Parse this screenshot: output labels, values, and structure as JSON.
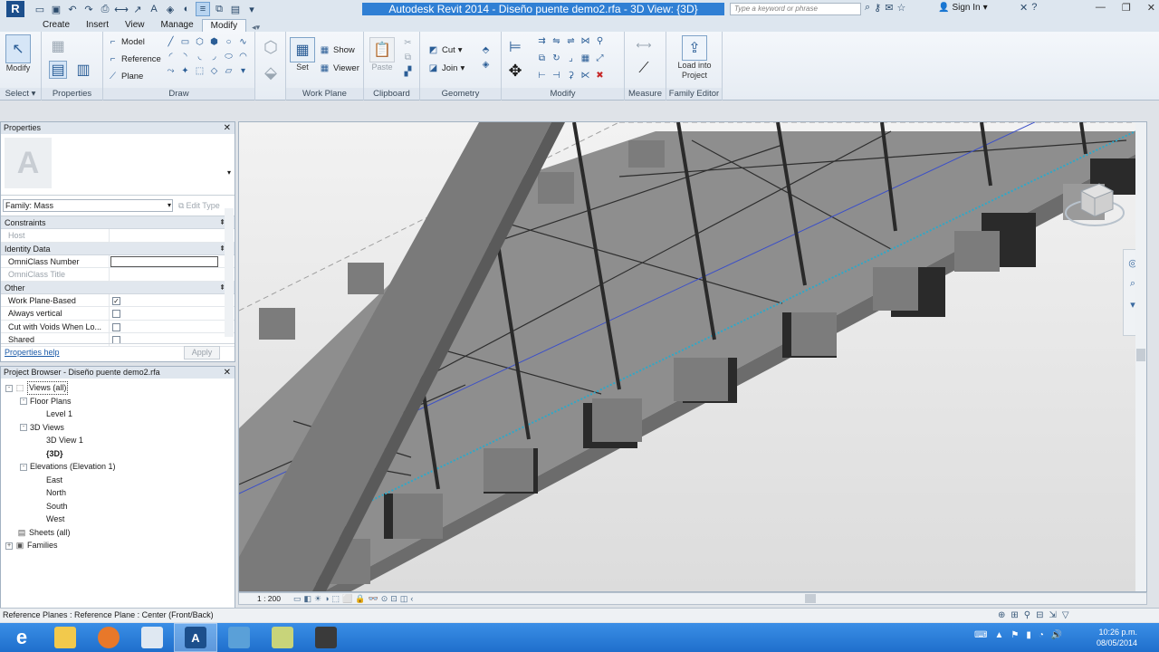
{
  "window": {
    "title": "Autodesk Revit 2014  -  Diseño puente demo2.rfa - 3D View: {3D}",
    "search_placeholder": "Type a keyword or phrase",
    "sign_in": "Sign In"
  },
  "ribbon": {
    "tabs": [
      "Create",
      "Insert",
      "View",
      "Manage",
      "Modify"
    ],
    "active_tab": "Modify",
    "panels": {
      "select": {
        "label": "Select",
        "modify_label": "Modify"
      },
      "properties": {
        "label": "Properties"
      },
      "draw": {
        "label": "Draw",
        "model": "Model",
        "reference": "Reference",
        "plane": "Plane"
      },
      "work_plane": {
        "label": "Work Plane",
        "set": "Set",
        "show": "Show",
        "viewer": "Viewer"
      },
      "clipboard": {
        "label": "Clipboard",
        "paste": "Paste"
      },
      "geometry": {
        "label": "Geometry",
        "cut": "Cut",
        "join": "Join"
      },
      "modify": {
        "label": "Modify"
      },
      "measure": {
        "label": "Measure"
      },
      "family_editor": {
        "label": "Family Editor",
        "load_into_project": "Load into Project"
      }
    }
  },
  "properties_palette": {
    "title": "Properties",
    "family_select": "Family: Mass",
    "edit_type": "Edit Type",
    "groups": [
      {
        "name": "Constraints",
        "rows": [
          {
            "name": "Host",
            "dim": true,
            "type": "text",
            "value": ""
          }
        ]
      },
      {
        "name": "Identity Data",
        "rows": [
          {
            "name": "OmniClass Number",
            "dim": false,
            "type": "field",
            "value": ""
          },
          {
            "name": "OmniClass Title",
            "dim": true,
            "type": "text",
            "value": ""
          }
        ]
      },
      {
        "name": "Other",
        "rows": [
          {
            "name": "Work Plane-Based",
            "dim": false,
            "type": "check",
            "checked": true
          },
          {
            "name": "Always vertical",
            "dim": false,
            "type": "check",
            "checked": false
          },
          {
            "name": "Cut with Voids When Lo...",
            "dim": false,
            "type": "check",
            "checked": false
          },
          {
            "name": "Shared",
            "dim": false,
            "type": "check",
            "checked": false
          }
        ]
      }
    ],
    "help_link": "Properties help",
    "apply": "Apply"
  },
  "project_browser": {
    "title": "Project Browser - Diseño puente demo2.rfa",
    "items": [
      {
        "label": "Views (all)",
        "level": 0,
        "toggle": "-",
        "icon": "views",
        "selected": true
      },
      {
        "label": "Floor Plans",
        "level": 1,
        "toggle": "-"
      },
      {
        "label": "Level 1",
        "level": 2
      },
      {
        "label": "3D Views",
        "level": 1,
        "toggle": "-"
      },
      {
        "label": "3D View 1",
        "level": 2
      },
      {
        "label": "{3D}",
        "level": 2,
        "bold": true
      },
      {
        "label": "Elevations (Elevation 1)",
        "level": 1,
        "toggle": "-"
      },
      {
        "label": "East",
        "level": 2
      },
      {
        "label": "North",
        "level": 2
      },
      {
        "label": "South",
        "level": 2
      },
      {
        "label": "West",
        "level": 2
      },
      {
        "label": "Sheets (all)",
        "level": 0,
        "icon": "sheets"
      },
      {
        "label": "Families",
        "level": 0,
        "toggle": "+",
        "icon": "families"
      }
    ]
  },
  "view_control": {
    "scale": "1 : 200"
  },
  "status": {
    "text": "Reference Planes : Reference Plane : Center (Front/Back)"
  },
  "clock": {
    "time": "10:26 p.m.",
    "date": "08/05/2014"
  }
}
